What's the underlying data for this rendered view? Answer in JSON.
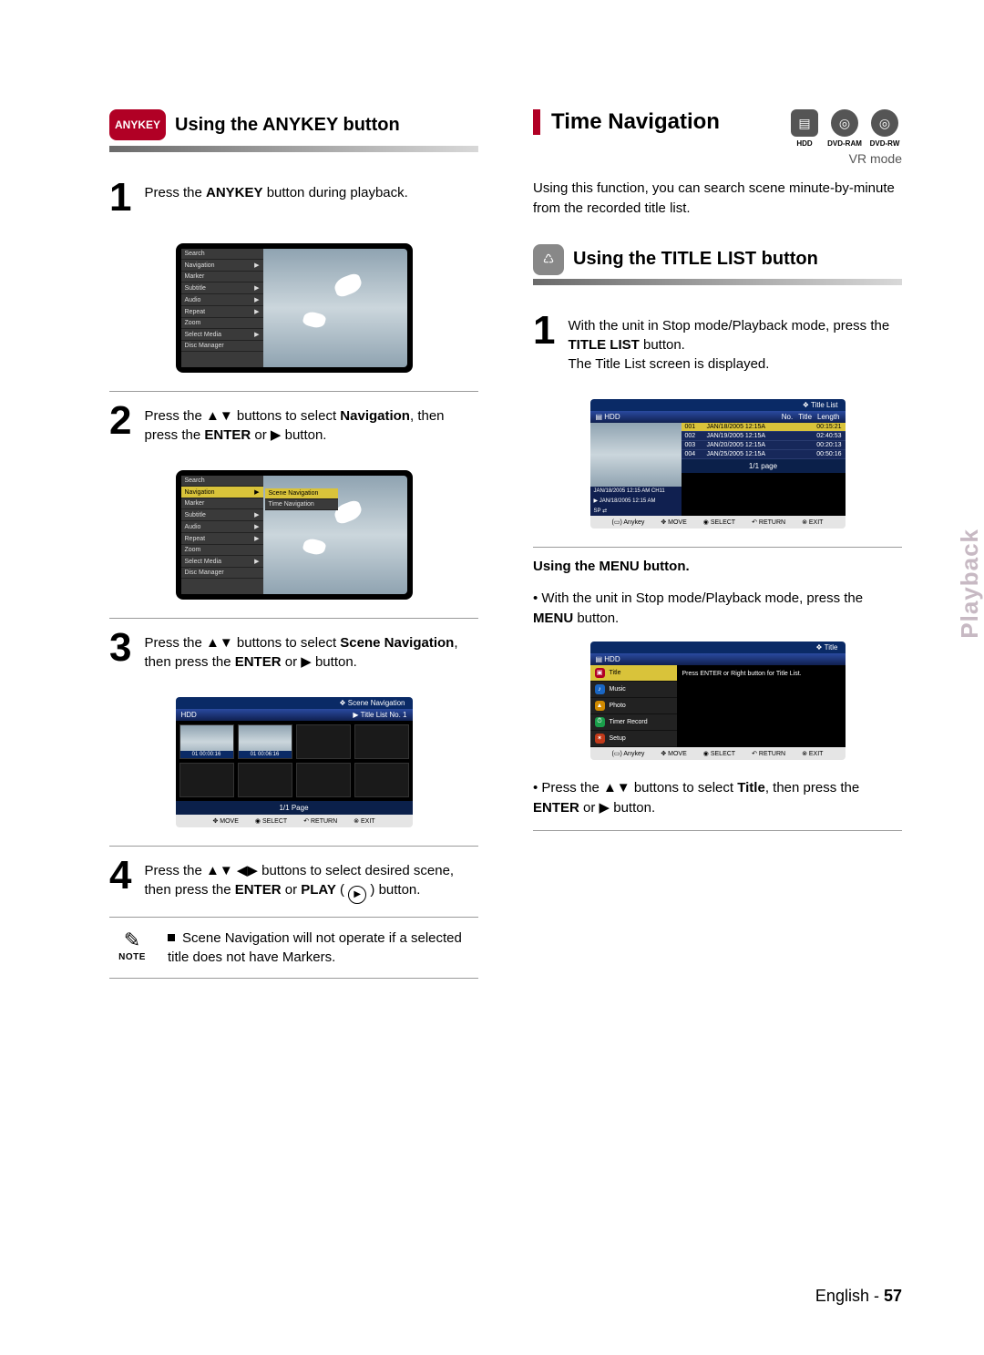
{
  "left": {
    "anykey_badge": "ANYKEY",
    "heading": "Using the ANYKEY button",
    "step1": {
      "n": "1",
      "pre": "Press the ",
      "b1": "ANYKEY",
      "post": " button during playback."
    },
    "step2": {
      "n": "2",
      "pre": "Press the ",
      "arrows": "▲▼",
      "mid": " buttons to select ",
      "b1": "Navigation",
      "post1": ", then press the ",
      "b2": "ENTER",
      "post2": " or ",
      "arrow_r": "▶",
      "post3": " button."
    },
    "step3": {
      "n": "3",
      "pre": "Press the ",
      "arrows": "▲▼",
      "mid": " buttons to select ",
      "b1": "Scene Navigation",
      "post1": ", then press the ",
      "b2": "ENTER",
      "post2": " or ",
      "arrow_r": "▶",
      "post3": " button."
    },
    "step4": {
      "n": "4",
      "pre": "Press the ",
      "arrows": "▲▼ ◀▶",
      "mid": " buttons to select desired scene, then press the ",
      "b1": "ENTER",
      "post1": " or ",
      "b2": "PLAY",
      "post2": " ( ",
      "glyph": "▶",
      "post3": " ) button."
    },
    "note": {
      "label": "NOTE",
      "text": "Scene Navigation will not operate if a selected title does not have Markers."
    },
    "osd_menu_items": [
      "Search",
      "Navigation",
      "Marker",
      "Subtitle",
      "Audio",
      "Repeat",
      "Zoom",
      "Select Media",
      "Disc Manager"
    ],
    "osd_submenu": [
      "Scene Navigation",
      "Time Navigation"
    ],
    "scene_nav": {
      "top": "Scene Navigation",
      "hdd": "HDD",
      "list_label": "Title List   No.  1",
      "thumbs": [
        "01  00:00:16",
        "01  00:06:16"
      ],
      "pager": "1/1 Page"
    },
    "footer_bar": {
      "anykey": "Anykey",
      "move": "MOVE",
      "select": "SELECT",
      "return": "RETURN",
      "exit": "EXIT"
    }
  },
  "right": {
    "section_title": "Time Navigation",
    "icons": {
      "hdd": "HDD",
      "ram": "DVD-RAM",
      "rw": "DVD-RW"
    },
    "mode_label": "VR mode",
    "intro": "Using this function, you can search scene minute-by-minute from the recorded title list.",
    "subhead": "Using the TITLE LIST button",
    "step1": {
      "n": "1",
      "pre": "With the unit in Stop mode/Playback mode, press the ",
      "b1": "TITLE LIST",
      "post1": " button.",
      "line2": "The Title List screen is displayed."
    },
    "title_list": {
      "top": "Title List",
      "hdd": "HDD",
      "cols": {
        "no": "No.",
        "title": "Title",
        "length": "Length"
      },
      "rows": [
        {
          "no": "001",
          "title": "JAN/18/2005 12:15A",
          "len": "00:15:21"
        },
        {
          "no": "002",
          "title": "JAN/19/2005 12:15A",
          "len": "02:40:53"
        },
        {
          "no": "003",
          "title": "JAN/20/2005 12:15A",
          "len": "00:20:13"
        },
        {
          "no": "004",
          "title": "JAN/25/2005 12:15A",
          "len": "00:50:16"
        }
      ],
      "meta1": "JAN/18/2005 12:15 AM CH11",
      "meta2": "JAN/18/2005 12:15 AM",
      "meta3": "SP ⇄",
      "pager": "1/1 page"
    },
    "menu_heading": "Using the MENU button.",
    "menu_p1_pre": "• With the unit in Stop mode/Playback mode, press the ",
    "menu_p1_b": "MENU",
    "menu_p1_post": " button.",
    "menu_osd": {
      "top": "Title",
      "hdd": "HDD",
      "items": [
        {
          "icon": "▣",
          "label": "Title",
          "sel": true,
          "color": "#b10025"
        },
        {
          "icon": "♪",
          "label": "Music",
          "sel": false,
          "color": "#1a66c2"
        },
        {
          "icon": "▲",
          "label": "Photo",
          "sel": false,
          "color": "#d08a00"
        },
        {
          "icon": "⏱",
          "label": "Timer Record",
          "sel": false,
          "color": "#1a9e4a"
        },
        {
          "icon": "✶",
          "label": "Setup",
          "sel": false,
          "color": "#c23a1a"
        }
      ],
      "msg": "Press ENTER or Right button for Title List."
    },
    "menu_p2_pre": "• Press the ",
    "menu_p2_arrows": "▲▼",
    "menu_p2_mid": " buttons to select ",
    "menu_p2_b": "Title",
    "menu_p2_post1": ", then press the ",
    "menu_p2_b2": "ENTER",
    "menu_p2_post2": " or ",
    "menu_p2_arrow_r": "▶",
    "menu_p2_post3": " button."
  },
  "side_tab": "Playback",
  "footer": {
    "lang": "English",
    "sep": " - ",
    "page": "57"
  }
}
